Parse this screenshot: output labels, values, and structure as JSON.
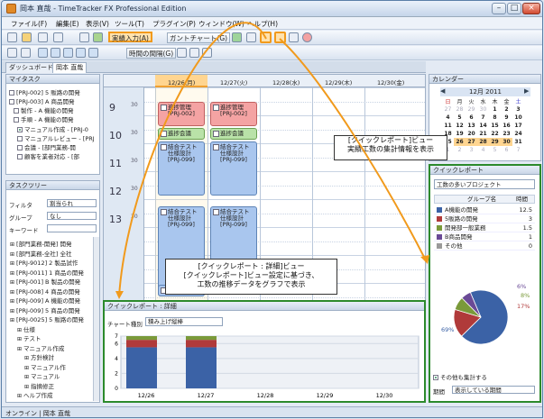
{
  "window": {
    "title": "岡本 直哉 - TimeTracker FX Professional Edition"
  },
  "menu": [
    "ファイル(F)",
    "編集(E)",
    "表示(V)",
    "ツール(T)",
    "プラグイン(P)",
    "ウィンドウ(W)",
    "ヘルプ(H)"
  ],
  "toolbar": {
    "actual_input": "実績入力(A)",
    "gantt": "ガントチャート(G)",
    "time_interval": "時間の間隔(G)"
  },
  "tabs": [
    "ダッシュボード",
    "岡本 直哉"
  ],
  "mytasks": {
    "title": "マイタスク",
    "items": [
      "[PRJ-002] 5 販路の開発",
      "[PRJ-003] A 商品開発",
      "製作 - A 機能の開発",
      "手順 - A 機能の開発",
      "マニュアル作成 - [PRJ-0",
      "マニュアルレビュー - [PRJ",
      "会議 - [部門業務-開",
      "顧客を業者対応 - [部"
    ]
  },
  "taskfilter": {
    "title": "タスクツリー",
    "filter_label": "フィルタ",
    "filter_value": "割当られ",
    "group_label": "グループ",
    "group_value": "なし",
    "keyword_label": "キーワード"
  },
  "tasktree": [
    "[部門業務-開発] 開発",
    "[部門業務-全社] 全社",
    "[PRJ-9012] 2 製品試作",
    "[PRJ-0011] 1 商品の開発",
    "[PRJ-001] B 製品の開発",
    "[PRJ-008] 4 商品の開発",
    "[PRJ-009] A 機能の開発",
    "[PRJ-009] 5 商品の開発",
    "[PRJ-0025] 5 販路の開発",
    "仕様",
    "テスト",
    "マニュアル作成",
    "方針検討",
    "マニュアル作",
    "マニュアル",
    "指摘修正",
    "ヘルプ作成"
  ],
  "calendar_days": [
    "12/26(月)",
    "12/27(火)",
    "12/28(水)",
    "12/29(木)",
    "12/30(金)"
  ],
  "hours": [
    "9",
    "10",
    "11",
    "12",
    "13"
  ],
  "events": [
    {
      "text": "進捗管理\n[PRJ-002]",
      "color": "red"
    },
    {
      "text": "進捗管理\n[PRJ-002]",
      "color": "red"
    },
    {
      "text": "進捗会議",
      "color": "green"
    },
    {
      "text": "進捗会議",
      "color": "green"
    },
    {
      "text": "結合テスト\n仕様設計\n[PRJ-099]",
      "color": "blue"
    },
    {
      "text": "結合テスト\n仕様設計\n[PRJ-099]",
      "color": "blue"
    },
    {
      "text": "結合テスト\n仕様設計\n[PRJ-099]",
      "color": "blue"
    },
    {
      "text": "結合テスト\n仕様設計\n[PRJ-099]",
      "color": "blue"
    },
    {
      "text": "テスト",
      "color": "blue"
    }
  ],
  "minicalendar": {
    "panel_title": "カレンダー",
    "month": "12月 2011",
    "weekdays": [
      "日",
      "月",
      "火",
      "水",
      "木",
      "金",
      "土"
    ],
    "weeks": [
      [
        "27",
        "28",
        "29",
        "30",
        "1",
        "2",
        "3"
      ],
      [
        "4",
        "5",
        "6",
        "7",
        "8",
        "9",
        "10"
      ],
      [
        "11",
        "12",
        "13",
        "14",
        "15",
        "16",
        "17"
      ],
      [
        "18",
        "19",
        "20",
        "21",
        "22",
        "23",
        "24"
      ],
      [
        "25",
        "26",
        "27",
        "28",
        "29",
        "30",
        "31"
      ],
      [
        "1",
        "2",
        "3",
        "4",
        "5",
        "6",
        "7"
      ]
    ]
  },
  "quickreport": {
    "title": "クイックレポート",
    "selector": "工数の多いプロジェクト",
    "col_group": "グループ名",
    "col_time": "時間",
    "rows": [
      {
        "name": "A機能の開発",
        "value": "12.5",
        "color": "#3b62a6"
      },
      {
        "name": "5販路の開発",
        "value": "3",
        "color": "#b03a3a"
      },
      {
        "name": "開発部一般業務",
        "value": "1.5",
        "color": "#7a9a3a"
      },
      {
        "name": "B商品開発",
        "value": "1",
        "color": "#6a4a96"
      },
      {
        "name": "その他",
        "value": "0",
        "color": "#9a9a9a"
      }
    ],
    "pie": [
      {
        "label": "69%",
        "value": 69,
        "color": "#3b62a6"
      },
      {
        "label": "17%",
        "value": 17,
        "color": "#b03a3a"
      },
      {
        "label": "8%",
        "value": 8,
        "color": "#7a9a3a"
      },
      {
        "label": "6%",
        "value": 6,
        "color": "#6a4a96"
      }
    ],
    "sum_other": "その他も集計する",
    "period_label": "期間",
    "period_value": "表示している期間"
  },
  "detail": {
    "title": "クイックレポート : 詳細",
    "chart_type_label": "チャート種別",
    "chart_type_value": "積み上げ縦棒"
  },
  "chart_data": {
    "type": "bar",
    "categories": [
      "12/26",
      "12/27",
      "12/28",
      "12/29",
      "12/30"
    ],
    "series": [
      {
        "values": [
          5.5,
          5.5,
          0,
          0,
          0
        ],
        "color": "#3b62a6"
      },
      {
        "values": [
          1,
          1,
          0,
          0,
          0
        ],
        "color": "#b03a3a"
      },
      {
        "values": [
          0.5,
          0.5,
          0,
          0,
          0
        ],
        "color": "#7a9a3a"
      }
    ],
    "ylim": [
      0,
      7
    ],
    "yticks": [
      "7",
      "6",
      "4",
      "2",
      "0"
    ]
  },
  "callouts": {
    "top": "[クイックレポート]ビュー\n実績工数の集計情報を表示",
    "bottom": "[クイックレポート : 詳細]ビュー\n[クイックレポート]ビュー設定に基づき、\n工数の推移データをグラフで表示"
  },
  "status": {
    "text": "オンライン | 岡本 直哉"
  }
}
